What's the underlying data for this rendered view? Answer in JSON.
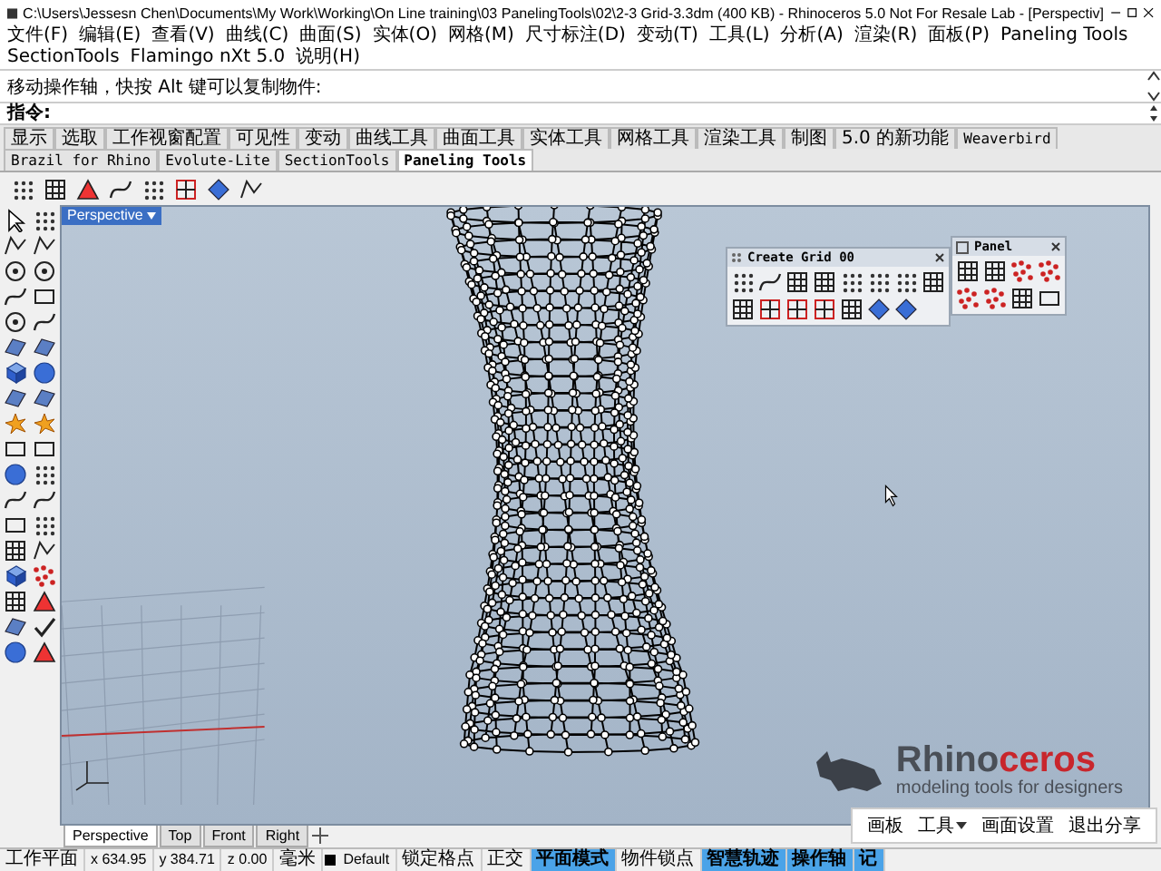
{
  "window": {
    "title": "C:\\Users\\Jessesn Chen\\Documents\\My Work\\Working\\On Line training\\03 PanelingTools\\02\\2-3 Grid-3.3dm (400 KB) - Rhinoceros 5.0 Not For Resale Lab - [Perspectiv]"
  },
  "menu": [
    "文件(F)",
    "编辑(E)",
    "查看(V)",
    "曲线(C)",
    "曲面(S)",
    "实体(O)",
    "网格(M)",
    "尺寸标注(D)",
    "变动(T)",
    "工具(L)",
    "分析(A)",
    "渲染(R)",
    "面板(P)",
    "Paneling Tools",
    "SectionTools",
    "Flamingo nXt 5.0",
    "说明(H)"
  ],
  "command_history": "移动操作轴，快按 Alt 键可以复制物件:",
  "command_prompt": "指令:",
  "toolbar_tabs": [
    {
      "label": "显示",
      "selected": false
    },
    {
      "label": "选取",
      "selected": false
    },
    {
      "label": "工作视窗配置",
      "selected": false
    },
    {
      "label": "可见性",
      "selected": false
    },
    {
      "label": "变动",
      "selected": false
    },
    {
      "label": "曲线工具",
      "selected": false
    },
    {
      "label": "曲面工具",
      "selected": false
    },
    {
      "label": "实体工具",
      "selected": false
    },
    {
      "label": "网格工具",
      "selected": false
    },
    {
      "label": "渲染工具",
      "selected": false
    },
    {
      "label": "制图",
      "selected": false
    },
    {
      "label": "5.0 的新功能",
      "selected": false
    },
    {
      "label": "Weaverbird",
      "selected": false
    },
    {
      "label": "Brazil for Rhino",
      "selected": false
    },
    {
      "label": "Evolute-Lite",
      "selected": false
    },
    {
      "label": "SectionTools",
      "selected": false
    },
    {
      "label": "Paneling Tools",
      "selected": true
    }
  ],
  "viewport": {
    "title": "Perspective",
    "wordmark": [
      "Rhino",
      "ceros"
    ],
    "tagline": "modeling tools for designers"
  },
  "floating_panels": [
    {
      "title": "Create Grid 00"
    },
    {
      "title": "Panel"
    }
  ],
  "viewport_tabs": [
    {
      "label": "Perspective",
      "selected": true
    },
    {
      "label": "Top",
      "selected": false
    },
    {
      "label": "Front",
      "selected": false
    },
    {
      "label": "Right",
      "selected": false
    }
  ],
  "share_bar": [
    "画板",
    "工具",
    "画面设置",
    "退出分享"
  ],
  "status_bar": {
    "cplane": "工作平面",
    "x": "x 634.95",
    "y": "y 384.71",
    "z": "z 0.00",
    "units": "毫米",
    "layer": "Default",
    "toggles": [
      {
        "label": "锁定格点",
        "on": false
      },
      {
        "label": "正交",
        "on": false
      },
      {
        "label": "平面模式",
        "on": true
      },
      {
        "label": "物件锁点",
        "on": false
      },
      {
        "label": "智慧轨迹",
        "on": true
      },
      {
        "label": "操作轴",
        "on": true
      },
      {
        "label": "记",
        "on": true
      }
    ]
  }
}
